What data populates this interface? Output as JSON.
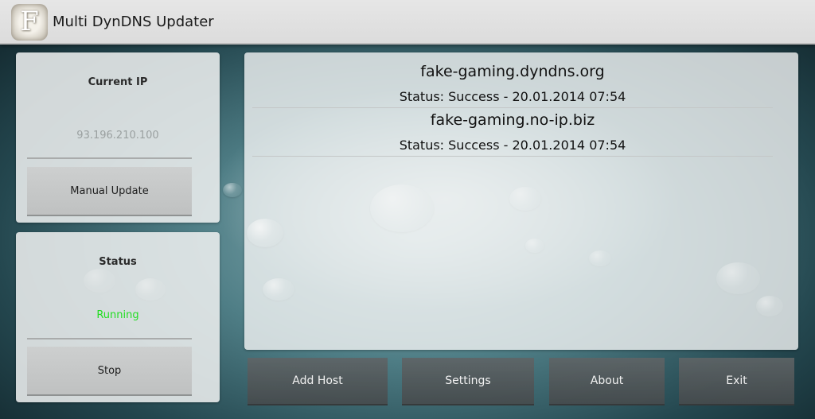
{
  "app": {
    "title": "Multi DynDNS Updater",
    "icon_letter": "F",
    "icon": "app-logo-icon"
  },
  "current_ip_card": {
    "title": "Current IP",
    "value": "93.196.210.100",
    "button_label": "Manual Update"
  },
  "status_card": {
    "title": "Status",
    "value": "Running",
    "value_color": "#22dd22",
    "button_label": "Stop"
  },
  "hosts": [
    {
      "name": "fake-gaming.dyndns.org",
      "status": "Status: Success - 20.01.2014 07:54"
    },
    {
      "name": "fake-gaming.no-ip.biz",
      "status": "Status: Success - 20.01.2014 07:54"
    }
  ],
  "bottom_bar": {
    "add_host": "Add Host",
    "settings": "Settings",
    "about": "About",
    "exit": "Exit"
  }
}
